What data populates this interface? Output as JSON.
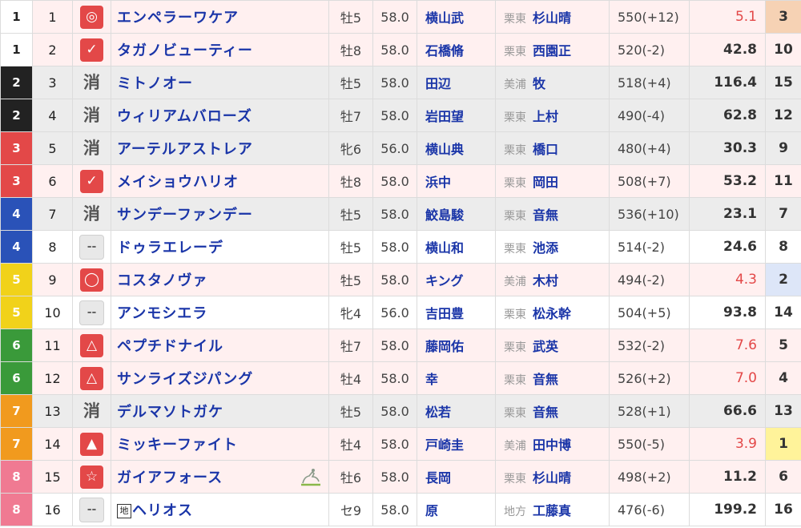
{
  "colors": {
    "waku": {
      "1": "#ffffff",
      "2": "#222222",
      "3": "#e34848",
      "4": "#2a52b8",
      "5": "#f1d21a",
      "6": "#3a9a3a",
      "7": "#f19a1e",
      "8": "#f07a92"
    },
    "waku_text": {
      "1": "#222222",
      "2": "#ffffff",
      "3": "#ffffff",
      "4": "#ffffff",
      "5": "#ffffff",
      "6": "#ffffff",
      "7": "#ffffff",
      "8": "#ffffff"
    },
    "ninki_highlight": {
      "1": "#fff39a",
      "2": "#dde6f8",
      "3": "#f6d2b4"
    }
  },
  "rows": [
    {
      "waku": "1",
      "umaban": "1",
      "mark": "◎",
      "mark_type": "red",
      "icon": "double-circle-mark-icon",
      "name": "エンペラーワケア",
      "sexage": "牡5",
      "kin": "58.0",
      "jockey": "横山武",
      "region": "栗東",
      "trainer": "杉山晴",
      "weight": "550(+12)",
      "odds": "5.1",
      "ninki": "3",
      "odds_hot": true
    },
    {
      "waku": "1",
      "umaban": "2",
      "mark": "✓",
      "mark_type": "red",
      "icon": "check-mark-icon",
      "name": "タガノビューティー",
      "sexage": "牡8",
      "kin": "58.0",
      "jockey": "石橋脩",
      "region": "栗東",
      "trainer": "西園正",
      "weight": "520(-2)",
      "odds": "42.8",
      "ninki": "10"
    },
    {
      "waku": "2",
      "umaban": "3",
      "mark": "消",
      "mark_type": "kesu",
      "icon": "erase-mark-icon",
      "name": "ミトノオー",
      "sexage": "牡5",
      "kin": "58.0",
      "jockey": "田辺",
      "region": "美浦",
      "trainer": "牧",
      "weight": "518(+4)",
      "odds": "116.4",
      "ninki": "15"
    },
    {
      "waku": "2",
      "umaban": "4",
      "mark": "消",
      "mark_type": "kesu",
      "icon": "erase-mark-icon",
      "name": "ウィリアムバローズ",
      "sexage": "牡7",
      "kin": "58.0",
      "jockey": "岩田望",
      "region": "栗東",
      "trainer": "上村",
      "weight": "490(-4)",
      "odds": "62.8",
      "ninki": "12"
    },
    {
      "waku": "3",
      "umaban": "5",
      "mark": "消",
      "mark_type": "kesu",
      "icon": "erase-mark-icon",
      "name": "アーテルアストレア",
      "sexage": "牝6",
      "kin": "56.0",
      "jockey": "横山典",
      "region": "栗東",
      "trainer": "橋口",
      "weight": "480(+4)",
      "odds": "30.3",
      "ninki": "9"
    },
    {
      "waku": "3",
      "umaban": "6",
      "mark": "✓",
      "mark_type": "red",
      "icon": "check-mark-icon",
      "name": "メイショウハリオ",
      "sexage": "牡8",
      "kin": "58.0",
      "jockey": "浜中",
      "region": "栗東",
      "trainer": "岡田",
      "weight": "508(+7)",
      "odds": "53.2",
      "ninki": "11"
    },
    {
      "waku": "4",
      "umaban": "7",
      "mark": "消",
      "mark_type": "kesu",
      "icon": "erase-mark-icon",
      "name": "サンデーファンデー",
      "sexage": "牡5",
      "kin": "58.0",
      "jockey": "鮫島駿",
      "region": "栗東",
      "trainer": "音無",
      "weight": "536(+10)",
      "odds": "23.1",
      "ninki": "7"
    },
    {
      "waku": "4",
      "umaban": "8",
      "mark": "--",
      "mark_type": "none",
      "icon": "no-mark-icon",
      "name": "ドゥラエレーデ",
      "sexage": "牡5",
      "kin": "58.0",
      "jockey": "横山和",
      "region": "栗東",
      "trainer": "池添",
      "weight": "514(-2)",
      "odds": "24.6",
      "ninki": "8"
    },
    {
      "waku": "5",
      "umaban": "9",
      "mark": "◯",
      "mark_type": "red",
      "icon": "circle-mark-icon",
      "name": "コスタノヴァ",
      "sexage": "牡5",
      "kin": "58.0",
      "jockey": "キング",
      "region": "美浦",
      "trainer": "木村",
      "weight": "494(-2)",
      "odds": "4.3",
      "ninki": "2",
      "odds_hot": true
    },
    {
      "waku": "5",
      "umaban": "10",
      "mark": "--",
      "mark_type": "none",
      "icon": "no-mark-icon",
      "name": "アンモシエラ",
      "sexage": "牝4",
      "kin": "56.0",
      "jockey": "吉田豊",
      "region": "栗東",
      "trainer": "松永幹",
      "weight": "504(+5)",
      "odds": "93.8",
      "ninki": "14"
    },
    {
      "waku": "6",
      "umaban": "11",
      "mark": "△",
      "mark_type": "red",
      "icon": "triangle-outline-mark-icon",
      "name": "ペプチドナイル",
      "sexage": "牡7",
      "kin": "58.0",
      "jockey": "藤岡佑",
      "region": "栗東",
      "trainer": "武英",
      "weight": "532(-2)",
      "odds": "7.6",
      "ninki": "5",
      "odds_hot": true
    },
    {
      "waku": "6",
      "umaban": "12",
      "mark": "△",
      "mark_type": "red",
      "icon": "triangle-outline-mark-icon",
      "name": "サンライズジパング",
      "sexage": "牡4",
      "kin": "58.0",
      "jockey": "幸",
      "region": "栗東",
      "trainer": "音無",
      "weight": "526(+2)",
      "odds": "7.0",
      "ninki": "4",
      "odds_hot": true
    },
    {
      "waku": "7",
      "umaban": "13",
      "mark": "消",
      "mark_type": "kesu",
      "icon": "erase-mark-icon",
      "name": "デルマソトガケ",
      "sexage": "牡5",
      "kin": "58.0",
      "jockey": "松若",
      "region": "栗東",
      "trainer": "音無",
      "weight": "528(+1)",
      "odds": "66.6",
      "ninki": "13"
    },
    {
      "waku": "7",
      "umaban": "14",
      "mark": "▲",
      "mark_type": "red",
      "icon": "triangle-filled-mark-icon",
      "name": "ミッキーファイト",
      "sexage": "牡4",
      "kin": "58.0",
      "jockey": "戸崎圭",
      "region": "美浦",
      "trainer": "田中博",
      "weight": "550(-5)",
      "odds": "3.9",
      "ninki": "1",
      "odds_hot": true
    },
    {
      "waku": "8",
      "umaban": "15",
      "mark": "☆",
      "mark_type": "red",
      "icon": "star-mark-icon",
      "name": "ガイアフォース",
      "sexage": "牡6",
      "kin": "58.0",
      "jockey": "長岡",
      "region": "栗東",
      "trainer": "杉山晴",
      "weight": "498(+2)",
      "odds": "11.2",
      "ninki": "6",
      "has_win_icon": true
    },
    {
      "waku": "8",
      "umaban": "16",
      "mark": "--",
      "mark_type": "none",
      "icon": "no-mark-icon",
      "name": "ヘリオス",
      "chi": "地",
      "sexage": "セ9",
      "kin": "58.0",
      "jockey": "原",
      "region": "地方",
      "trainer": "工藤真",
      "weight": "476(-6)",
      "odds": "199.2",
      "ninki": "16"
    }
  ]
}
